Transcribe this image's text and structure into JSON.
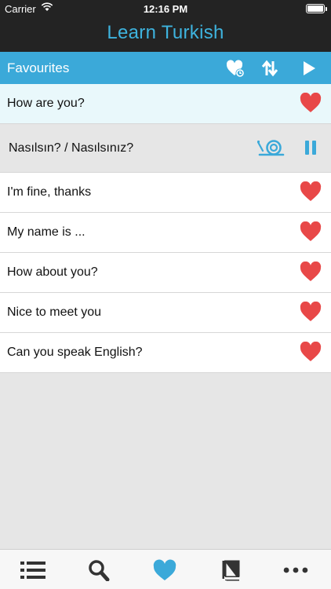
{
  "status_bar": {
    "carrier": "Carrier",
    "time": "12:16 PM",
    "battery": "full"
  },
  "app": {
    "title": "Learn Turkish"
  },
  "section": {
    "title": "Favourites",
    "tools": [
      "heart-sync-icon",
      "sort-icon",
      "play-icon"
    ]
  },
  "phrases": [
    {
      "text": "How are you?",
      "state": "highlighted",
      "favourite": true
    },
    {
      "text": "Nasılsın? / Nasılsınız?",
      "state": "translation",
      "controls": [
        "snail-slow-icon",
        "pause-icon"
      ]
    },
    {
      "text": "I'm fine, thanks",
      "favourite": true
    },
    {
      "text": "My name is ...",
      "favourite": true
    },
    {
      "text": "How about you?",
      "favourite": true
    },
    {
      "text": "Nice to meet you",
      "favourite": true
    },
    {
      "text": "Can you speak English?",
      "favourite": true
    }
  ],
  "tab_bar": {
    "tabs": [
      "list-icon",
      "search-icon",
      "heart-icon",
      "book-icon",
      "more-icon"
    ],
    "active": "heart-icon"
  },
  "colors": {
    "accent": "#3ba9d9",
    "heart": "#e84848",
    "header": "#232323",
    "highlight": "#e9f8fb"
  }
}
